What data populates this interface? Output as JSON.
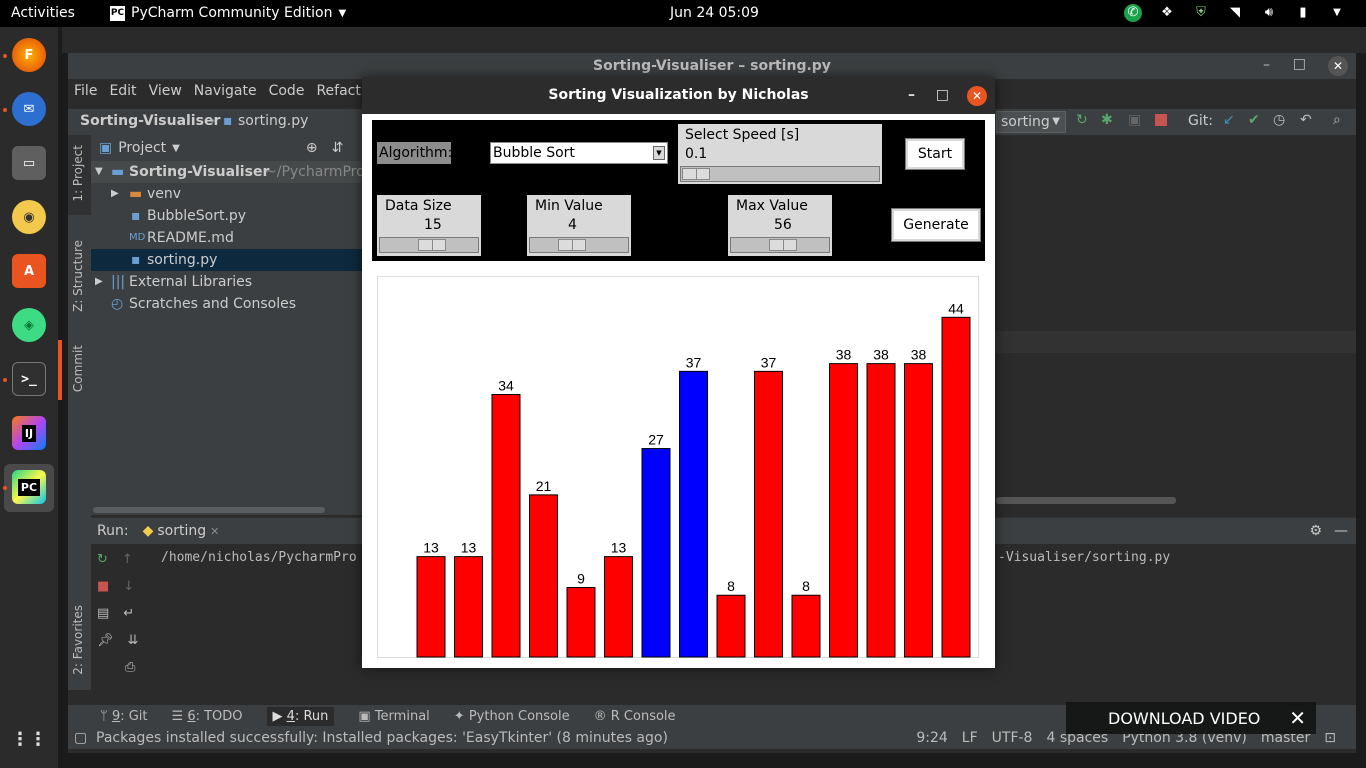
{
  "topbar": {
    "activities": "Activities",
    "app_name": "PyCharm Community Edition",
    "clock": "Jun 24  05:09"
  },
  "ide": {
    "title": "Sorting-Visualiser – sorting.py",
    "menu": [
      "File",
      "Edit",
      "View",
      "Navigate",
      "Code",
      "Refact"
    ],
    "breadcrumb_project": "Sorting-Visualiser",
    "breadcrumb_file": "sorting.py",
    "run_config": "sorting",
    "git_label": "Git:",
    "left_tabs": {
      "project": "1: Project",
      "structure": "Z: Structure",
      "commit": "Commit",
      "favorites": "2: Favorites"
    },
    "project_header": "Project",
    "tree": [
      {
        "label": "Sorting-Visualiser",
        "suffix": "~/PycharmPro",
        "indent": 0
      },
      {
        "label": "venv",
        "indent": 1
      },
      {
        "label": "BubbleSort.py",
        "indent": 2
      },
      {
        "label": "README.md",
        "indent": 2
      },
      {
        "label": "sorting.py",
        "indent": 2
      },
      {
        "label": "External Libraries",
        "indent": 0
      },
      {
        "label": "Scratches and Consoles",
        "indent": 0
      }
    ],
    "run_label": "Run:",
    "run_tab": "sorting",
    "run_output_left": "/home/nicholas/PycharmPro",
    "run_output_right": "-Visualiser/sorting.py",
    "tool_tabs": [
      {
        "num": "9",
        "rest": ": Git"
      },
      {
        "num": "6",
        "rest": ": TODO"
      },
      {
        "num": "4",
        "rest": ": Run"
      },
      {
        "num": "",
        "rest": "Terminal"
      },
      {
        "num": "",
        "rest": "Python Console"
      },
      {
        "num": "",
        "rest": "R Console"
      }
    ],
    "status_message": "Packages installed successfully: Installed packages: 'EasyTkinter' (8 minutes ago)",
    "status_right": [
      "9:24",
      "LF",
      "UTF-8",
      "4 spaces",
      "Python 3.8 (venv)",
      "master"
    ]
  },
  "download_video": "DOWNLOAD VIDEO",
  "tk": {
    "title": "Sorting Visualization by Nicholas",
    "algorithm_label": "Algorithm:",
    "algorithm_value": "Bubble Sort",
    "speed_label": "Select Speed [s]",
    "speed_value": "0.1",
    "start": "Start",
    "data_size_label": "Data Size",
    "data_size_value": "15",
    "min_label": "Min Value",
    "min_value": "4",
    "max_label": "Max Value",
    "max_value": "56",
    "generate": "Generate"
  },
  "chart_data": {
    "type": "bar",
    "values": [
      13,
      13,
      34,
      21,
      9,
      13,
      27,
      37,
      8,
      37,
      8,
      38,
      38,
      38,
      44
    ],
    "colors": [
      "#ff0000",
      "#ff0000",
      "#ff0000",
      "#ff0000",
      "#ff0000",
      "#ff0000",
      "#0000ff",
      "#0000ff",
      "#ff0000",
      "#ff0000",
      "#ff0000",
      "#ff0000",
      "#ff0000",
      "#ff0000",
      "#ff0000"
    ],
    "labels": [
      "13",
      "13",
      "34",
      "21",
      "9",
      "13",
      "27",
      "37",
      "8",
      "37",
      "8",
      "",
      "",
      "",
      "44"
    ],
    "extra_labels": [
      "38",
      "38",
      "38"
    ]
  }
}
